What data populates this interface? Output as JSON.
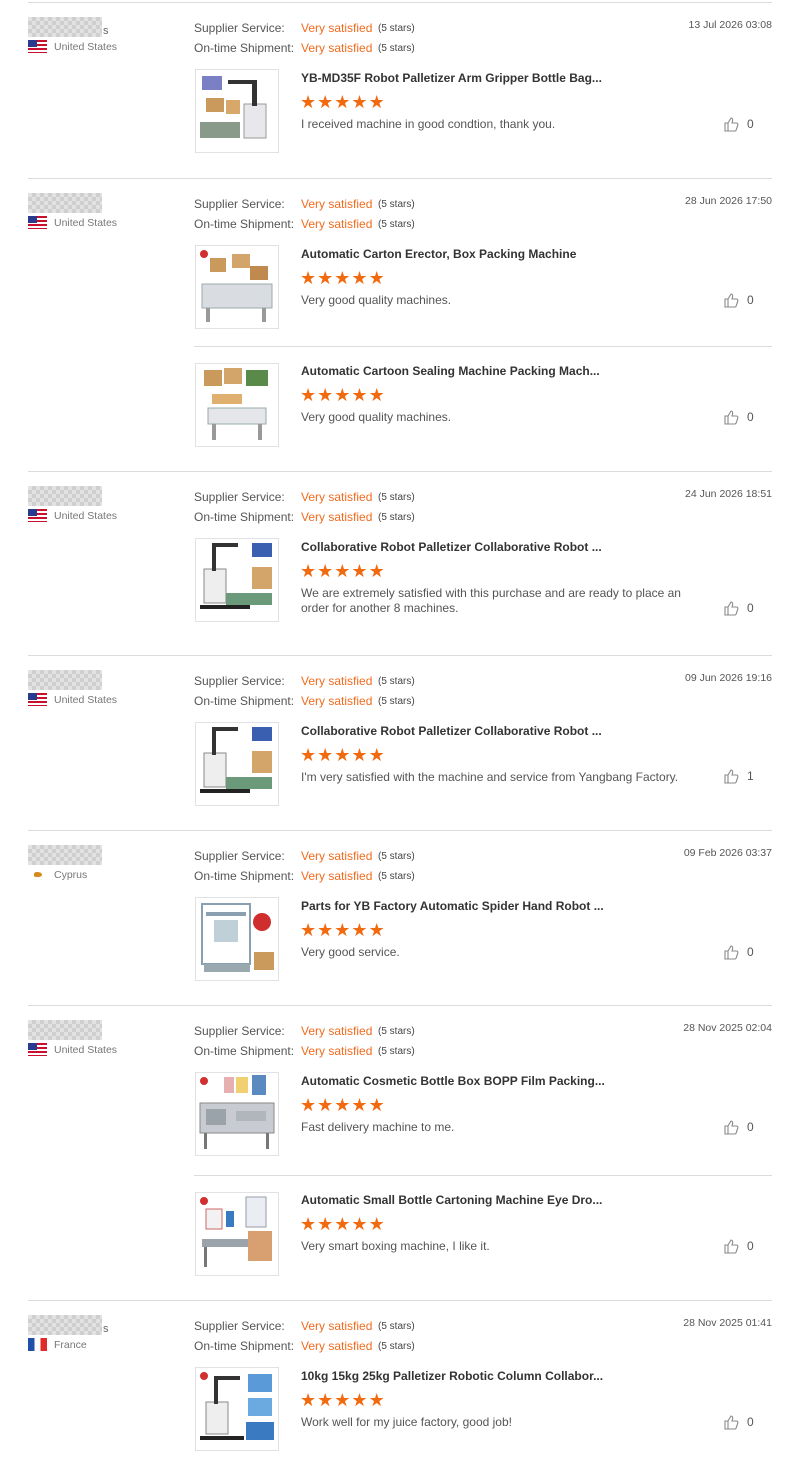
{
  "labels": {
    "supplier_service": "Supplier Service:",
    "ontime_shipment": "On-time Shipment:"
  },
  "colors": {
    "accent": "#f06b1e",
    "star": "#f26a10",
    "divider": "#dcdcdc"
  },
  "reviews": [
    {
      "name_suffix": "s",
      "flag": "us-flag-icon",
      "country": "United States",
      "date": "13 Jul 2026 03:08",
      "supplier_value": "Very satisfied",
      "supplier_stars": "(5 stars)",
      "shipment_value": "Very satisfied",
      "shipment_stars": "(5 stars)",
      "products": [
        {
          "title": "YB-MD35F Robot Palletizer Arm Gripper Bottle Bag...",
          "rating": 5,
          "comment": "I received machine in good condtion, thank you.",
          "likes": "0",
          "image": "robot-palletizer-image"
        }
      ]
    },
    {
      "name_suffix": "",
      "flag": "us-flag-icon",
      "country": "United States",
      "date": "28 Jun 2026 17:50",
      "supplier_value": "Very satisfied",
      "supplier_stars": "(5 stars)",
      "shipment_value": "Very satisfied",
      "shipment_stars": "(5 stars)",
      "products": [
        {
          "title": "Automatic Carton Erector, Box Packing Machine",
          "rating": 5,
          "comment": "Very good quality machines.",
          "likes": "0",
          "image": "carton-erector-image"
        },
        {
          "title": "Automatic Cartoon Sealing Machine Packing Mach...",
          "rating": 5,
          "comment": "Very good quality machines.",
          "likes": "0",
          "image": "carton-sealing-image"
        }
      ]
    },
    {
      "name_suffix": "",
      "flag": "us-flag-icon",
      "country": "United States",
      "date": "24 Jun 2026 18:51",
      "supplier_value": "Very satisfied",
      "supplier_stars": "(5 stars)",
      "shipment_value": "Very satisfied",
      "shipment_stars": "(5 stars)",
      "products": [
        {
          "title": "Collaborative Robot Palletizer Collaborative Robot ...",
          "rating": 5,
          "comment": "We are extremely satisfied with this purchase and are ready to place an order for another 8 machines.",
          "likes": "0",
          "image": "cobot-palletizer-image"
        }
      ]
    },
    {
      "name_suffix": "",
      "flag": "us-flag-icon",
      "country": "United States",
      "date": "09 Jun 2026 19:16",
      "supplier_value": "Very satisfied",
      "supplier_stars": "(5 stars)",
      "shipment_value": "Very satisfied",
      "shipment_stars": "(5 stars)",
      "products": [
        {
          "title": "Collaborative Robot Palletizer Collaborative Robot ...",
          "rating": 5,
          "comment": "I'm very satisfied with the machine and service from Yangbang Factory.",
          "likes": "1",
          "image": "cobot-palletizer-image"
        }
      ]
    },
    {
      "name_suffix": "",
      "flag": "cyprus-flag-icon",
      "country": "Cyprus",
      "date": "09 Feb 2026 03:37",
      "supplier_value": "Very satisfied",
      "supplier_stars": "(5 stars)",
      "shipment_value": "Very satisfied",
      "shipment_stars": "(5 stars)",
      "products": [
        {
          "title": "Parts for YB Factory Automatic Spider Hand Robot ...",
          "rating": 5,
          "comment": "Very good service.",
          "likes": "0",
          "image": "spider-robot-image"
        }
      ]
    },
    {
      "name_suffix": "",
      "flag": "us-flag-icon",
      "country": "United States",
      "date": "28 Nov 2025 02:04",
      "supplier_value": "Very satisfied",
      "supplier_stars": "(5 stars)",
      "shipment_value": "Very satisfied",
      "shipment_stars": "(5 stars)",
      "products": [
        {
          "title": "Automatic Cosmetic Bottle Box BOPP Film Packing...",
          "rating": 5,
          "comment": "Fast delivery machine to me.",
          "likes": "0",
          "image": "film-packing-image"
        },
        {
          "title": "Automatic Small Bottle Cartoning Machine Eye Dro...",
          "rating": 5,
          "comment": "Very smart boxing machine, I like it.",
          "likes": "0",
          "image": "cartoning-machine-image"
        }
      ]
    },
    {
      "name_suffix": "s",
      "flag": "france-flag-icon",
      "country": "France",
      "date": "28 Nov 2025 01:41",
      "supplier_value": "Very satisfied",
      "supplier_stars": "(5 stars)",
      "shipment_value": "Very satisfied",
      "shipment_stars": "(5 stars)",
      "products": [
        {
          "title": "10kg 15kg 25kg Palletizer Robotic Column Collabor...",
          "rating": 5,
          "comment": "Work well for my juice factory, good job!",
          "likes": "0",
          "image": "column-palletizer-image"
        }
      ]
    }
  ]
}
